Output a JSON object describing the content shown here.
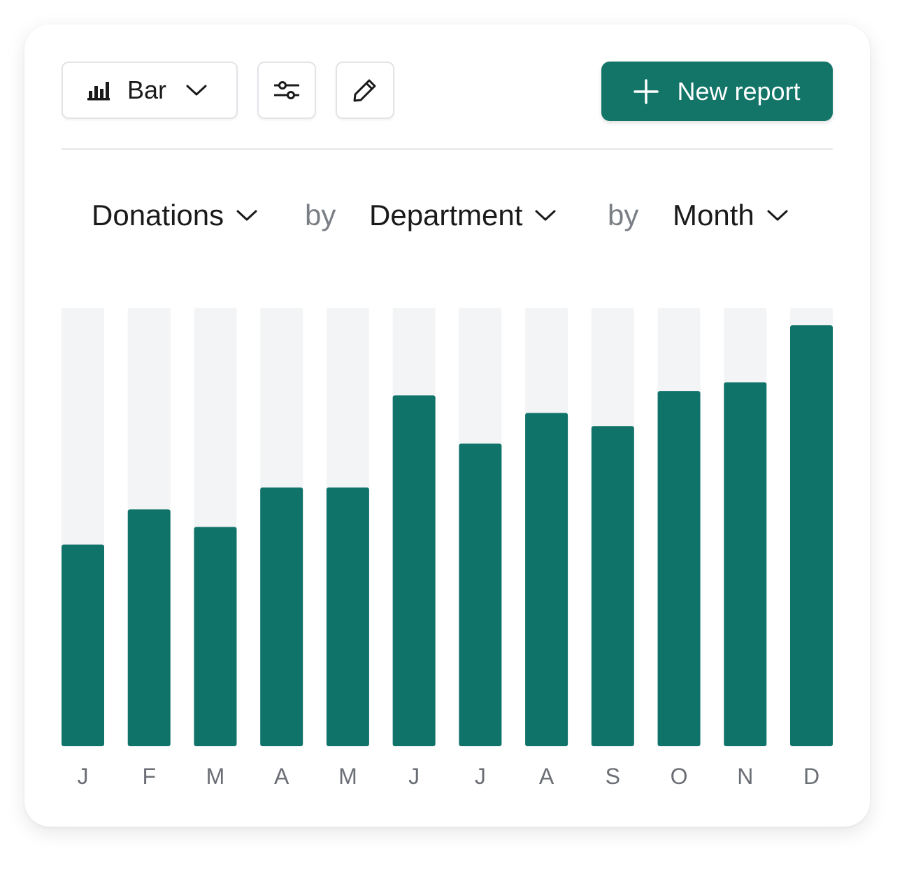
{
  "toolbar": {
    "chart_type_label": "Bar",
    "chart_type_icon": "bar-chart-icon",
    "filter_icon": "sliders-icon",
    "edit_icon": "pencil-icon",
    "new_report_label": "New report",
    "new_report_icon": "plus-icon"
  },
  "query": {
    "metric": "Donations",
    "by_1": "by",
    "group": "Department",
    "by_2": "by",
    "period": "Month"
  },
  "colors": {
    "accent": "#127568",
    "bar": "#10736A",
    "bar_track": "#F3F4F5",
    "axis_label": "#6b6f75"
  },
  "chart_data": {
    "type": "bar",
    "categories": [
      "J",
      "F",
      "M",
      "A",
      "M",
      "J",
      "J",
      "A",
      "S",
      "O",
      "N",
      "D"
    ],
    "values": [
      46,
      54,
      50,
      59,
      59,
      80,
      69,
      76,
      73,
      81,
      83,
      96
    ],
    "ylim": [
      0,
      100
    ],
    "grid": false,
    "legend": "none"
  }
}
